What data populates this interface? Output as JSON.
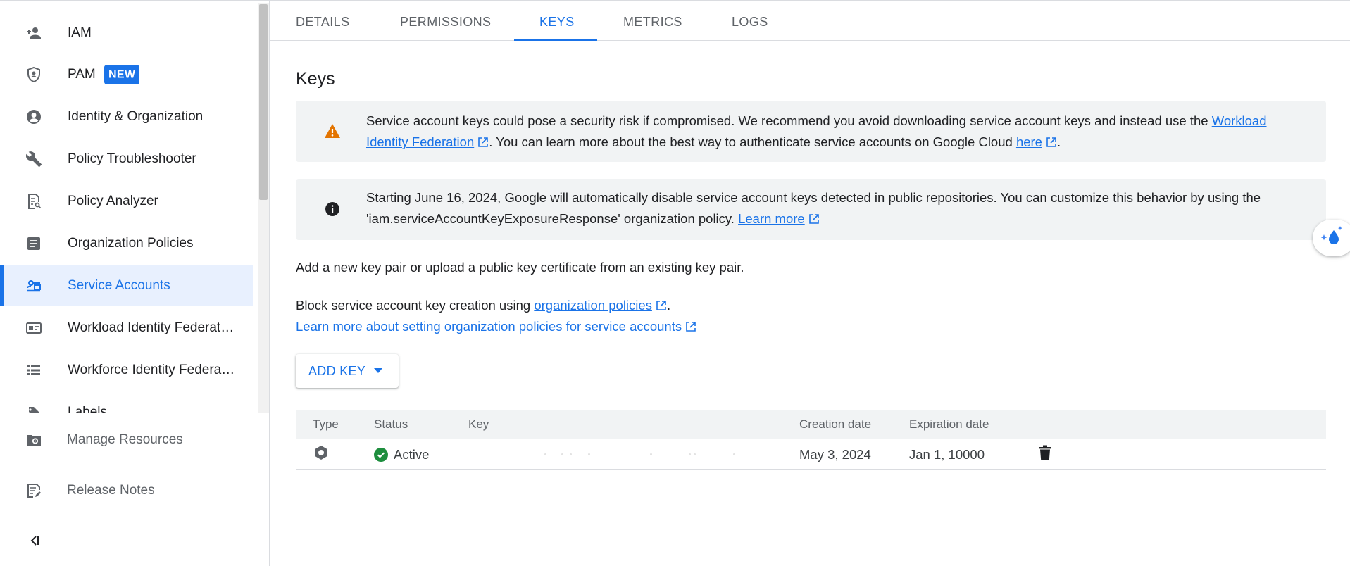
{
  "sidebar": {
    "items": [
      {
        "label": "IAM",
        "icon": "person-add-icon"
      },
      {
        "label": "PAM",
        "icon": "shield-icon",
        "badge": "NEW"
      },
      {
        "label": "Identity & Organization",
        "icon": "account-circle-icon"
      },
      {
        "label": "Policy Troubleshooter",
        "icon": "wrench-icon"
      },
      {
        "label": "Policy Analyzer",
        "icon": "document-search-icon"
      },
      {
        "label": "Organization Policies",
        "icon": "article-icon"
      },
      {
        "label": "Service Accounts",
        "icon": "service-account-icon",
        "active": true
      },
      {
        "label": "Workload Identity Federat…",
        "icon": "badge-icon"
      },
      {
        "label": "Workforce Identity Federa…",
        "icon": "list-icon"
      },
      {
        "label": "Labels",
        "icon": "label-icon"
      }
    ],
    "bottom": [
      {
        "label": "Manage Resources",
        "icon": "folder-gear-icon"
      },
      {
        "label": "Release Notes",
        "icon": "release-notes-icon"
      }
    ],
    "collapse_icon": "collapse-left-icon"
  },
  "tabs": [
    {
      "label": "DETAILS"
    },
    {
      "label": "PERMISSIONS"
    },
    {
      "label": "KEYS",
      "active": true
    },
    {
      "label": "METRICS"
    },
    {
      "label": "LOGS"
    }
  ],
  "page": {
    "title": "Keys",
    "warning": {
      "icon": "warning-icon",
      "text_before": "Service account keys could pose a security risk if compromised. We recommend you avoid downloading service account keys and instead use the ",
      "link1": "Workload Identity Federation",
      "text_middle": ". You can learn more about the best way to authenticate service accounts on Google Cloud ",
      "link2": "here",
      "text_after": "."
    },
    "info": {
      "icon": "info-icon",
      "text_before": "Starting June 16, 2024, Google will automatically disable service account keys detected in public repositories. You can customize this behavior by using the 'iam.serviceAccountKeyExposureResponse' organization policy. ",
      "link": "Learn more"
    },
    "add_key_text": "Add a new key pair or upload a public key certificate from an existing key pair.",
    "block_text_before": "Block service account key creation using ",
    "block_link": "organization policies",
    "block_text_after": ".",
    "learn_more_link": "Learn more about setting organization policies for service accounts",
    "add_key_button": "ADD KEY"
  },
  "table": {
    "headers": [
      "Type",
      "Status",
      "Key",
      "Creation date",
      "Expiration date"
    ],
    "rows": [
      {
        "type_icon": "key-type-icon",
        "status": "Active",
        "key": "",
        "creation_date": "May 3, 2024",
        "expiration_date": "Jan 1, 10000"
      }
    ]
  },
  "colors": {
    "accent": "#1a73e8",
    "warning": "#e37400",
    "success": "#1e8e3e",
    "banner_bg": "#f1f3f4"
  }
}
